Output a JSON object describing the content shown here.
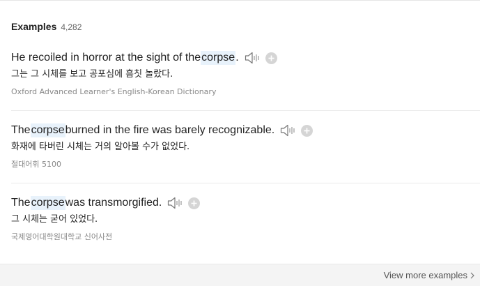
{
  "section": {
    "title": "Examples",
    "count": "4,282"
  },
  "examples": [
    {
      "before": "He recoiled in horror at the sight of the ",
      "keyword": "corpse",
      "after": ".",
      "translation": "그는 그 시체를 보고 공포심에 흠칫 놀랐다.",
      "source": "Oxford Advanced Learner's English-Korean Dictionary",
      "icons": [
        "speaker-icon",
        "plus-icon"
      ]
    },
    {
      "before": "The ",
      "keyword": "corpse",
      "after": " burned in the fire was barely recognizable.",
      "translation": "화재에 타버린 시체는 거의 알아볼 수가 없었다.",
      "source": "절대어휘 5100",
      "icons": [
        "speaker-icon",
        "plus-icon"
      ]
    },
    {
      "before": "The ",
      "keyword": "corpse",
      "after": " was transmorgified.",
      "translation": "그 시체는 굳어 있었다.",
      "source": "국제영어대학원대학교 신어사전",
      "icons": [
        "speaker-icon",
        "plus-icon"
      ]
    }
  ],
  "footer": {
    "view_more_label": "View more examples",
    "icon": "chevron-right-icon"
  },
  "colors": {
    "highlight": "#e8f2fb",
    "source_text": "#888888",
    "footer_bg": "#f4f4f4"
  }
}
